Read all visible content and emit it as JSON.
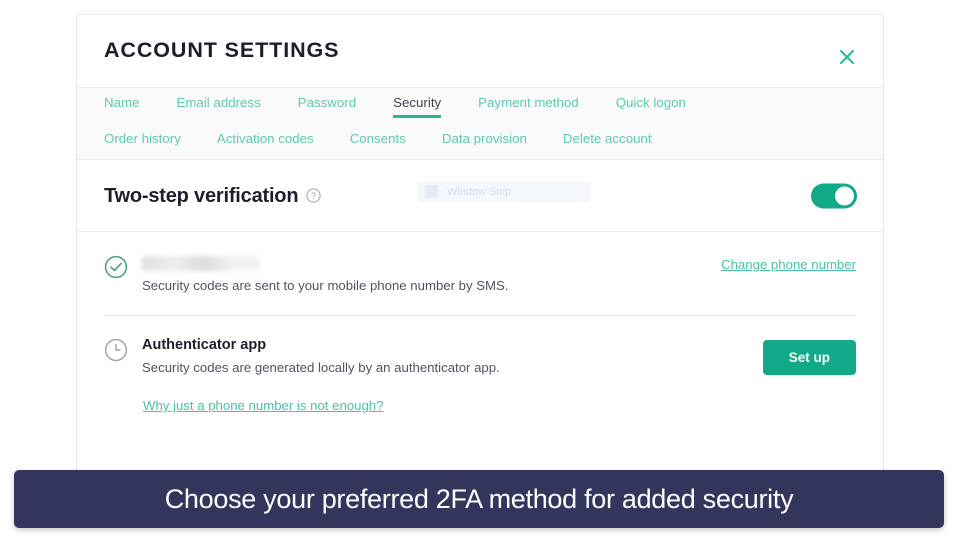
{
  "header": {
    "title": "ACCOUNT SETTINGS",
    "close_icon": "close-icon"
  },
  "tabs": {
    "row1": [
      {
        "label": "Name",
        "active": false
      },
      {
        "label": "Email address",
        "active": false
      },
      {
        "label": "Password",
        "active": false
      },
      {
        "label": "Security",
        "active": true
      },
      {
        "label": "Payment method",
        "active": false
      },
      {
        "label": "Quick logon",
        "active": false
      }
    ],
    "row2": [
      {
        "label": "Order history",
        "active": false
      },
      {
        "label": "Activation codes",
        "active": false
      },
      {
        "label": "Consents",
        "active": false
      },
      {
        "label": "Data provision",
        "active": false
      },
      {
        "label": "Delete account",
        "active": false
      }
    ]
  },
  "section": {
    "title": "Two-step verification",
    "help_icon": "question-mark-icon",
    "toggle_state": "on"
  },
  "overlay": {
    "snip_label": "Window Snip"
  },
  "methods": {
    "sms": {
      "status_icon": "check-circle-icon",
      "phone_number_redacted": "",
      "description": "Security codes are sent to your mobile phone number by SMS.",
      "action_link": "Change phone number"
    },
    "authenticator": {
      "status_icon": "clock-icon",
      "title": "Authenticator app",
      "description": "Security codes are generated locally by an authenticator app.",
      "action_button": "Set up"
    },
    "footer_link": "Why just a phone number is not enough?"
  },
  "caption": {
    "text": "Choose your preferred 2FA method for added security"
  },
  "colors": {
    "accent_teal": "#12a988",
    "link_teal": "#4ac0a4",
    "tab_teal": "#5fc9ae",
    "banner_navy": "#33355c",
    "title_dark": "#1c1f2b"
  }
}
